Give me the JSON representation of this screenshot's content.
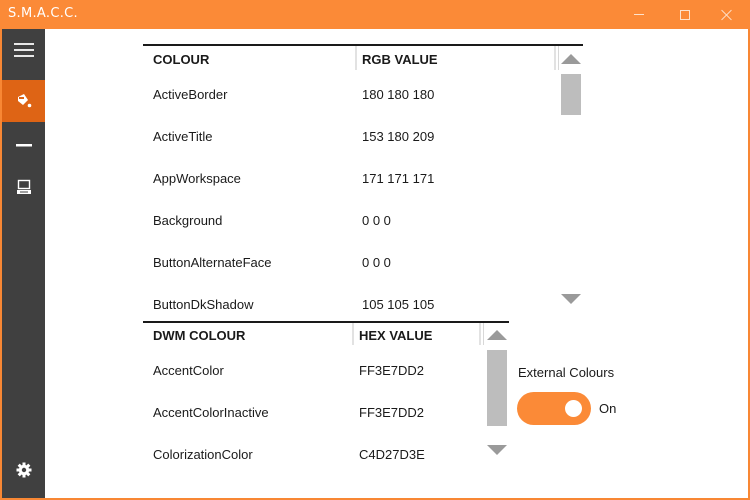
{
  "window": {
    "title": "S.M.A.C.C.",
    "controls": {
      "minimize": "minimize",
      "maximize": "maximize",
      "close": "close"
    },
    "accent_color": "#fb8a37",
    "selected_nav_color": "#de6415",
    "sidebar_color": "#404040"
  },
  "sidebar": {
    "items": [
      {
        "id": "menu",
        "icon": "hamburger-menu-icon",
        "selected": false
      },
      {
        "id": "colours",
        "icon": "paint-bucket-icon",
        "selected": true
      },
      {
        "id": "minus",
        "icon": "minus-icon",
        "selected": false
      },
      {
        "id": "computer",
        "icon": "computer-icon",
        "selected": false
      }
    ],
    "footer": {
      "id": "settings",
      "icon": "gear-icon"
    }
  },
  "system_colours_table": {
    "headers": [
      "COLOUR",
      "RGB VALUE"
    ],
    "rows": [
      {
        "name": "ActiveBorder",
        "value": "180 180 180"
      },
      {
        "name": "ActiveTitle",
        "value": "153 180 209"
      },
      {
        "name": "AppWorkspace",
        "value": "171 171 171"
      },
      {
        "name": "Background",
        "value": "0 0 0"
      },
      {
        "name": "ButtonAlternateFace",
        "value": "0 0 0"
      },
      {
        "name": "ButtonDkShadow",
        "value": "105 105 105"
      }
    ]
  },
  "dwm_colours_table": {
    "headers": [
      "DWM COLOUR",
      "HEX VALUE"
    ],
    "rows": [
      {
        "name": "AccentColor",
        "value": "FF3E7DD2"
      },
      {
        "name": "AccentColorInactive",
        "value": "FF3E7DD2"
      },
      {
        "name": "ColorizationColor",
        "value": "C4D27D3E"
      }
    ]
  },
  "external_colours": {
    "label": "External Colours",
    "state": "On",
    "enabled": true
  }
}
